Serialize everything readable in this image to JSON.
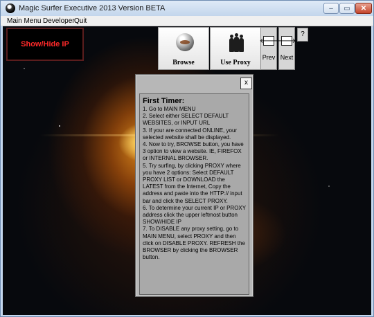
{
  "window": {
    "title": "Magic Surfer Executive 2013 Version BETA",
    "controls": {
      "minimize": "–",
      "maximize": "▭",
      "close": "✕"
    }
  },
  "menu": [
    "Main Menu",
    "Developer",
    "Quit"
  ],
  "toolbar": {
    "showhide_label": "Show/Hide IP",
    "browse_label": "Browse",
    "useproxy_label": "Use Proxy",
    "prev_label": "Prev",
    "next_label": "Next",
    "prev_arrow": "🡐",
    "next_arrow": "🡒",
    "help_label": "?"
  },
  "icons": {
    "browse": "globe-icon",
    "useproxy": "people-icon"
  },
  "help_panel": {
    "close_label": "x",
    "title": "First Timer:",
    "body": "1. Go to MAIN MENU\n2. Select either SELECT DEFAULT WEBSITES, or INPUT URL\n3. If your are connected ONLINE, your selected website shall be displayed.\n4. Now to try, BROWSE button, you have 3 option to view a website. IE, FIREFOX or INTERNAL BROWSER.\n5. Try surfing, by clicking PROXY where you have 2 options: Select DEFAULT PROXY LIST or DOWNLOAD the LATEST from the Internet, Copy the address and paste into the HTTP:// input bar and click the SELECT PROXY.\n6. To determine your current IP or PROXY address click the upper leftmost button SHOW/HIDE IP\n7. To DISABLE any proxy setting, go to MAIN MENU, select PROXY and then click on DISABLE PROXY. REFRESH the BROWSER by clicking the BROWSER button."
  },
  "colors": {
    "showhide_text": "#ff2a2a",
    "panel_bg": "#b7b7b7"
  }
}
